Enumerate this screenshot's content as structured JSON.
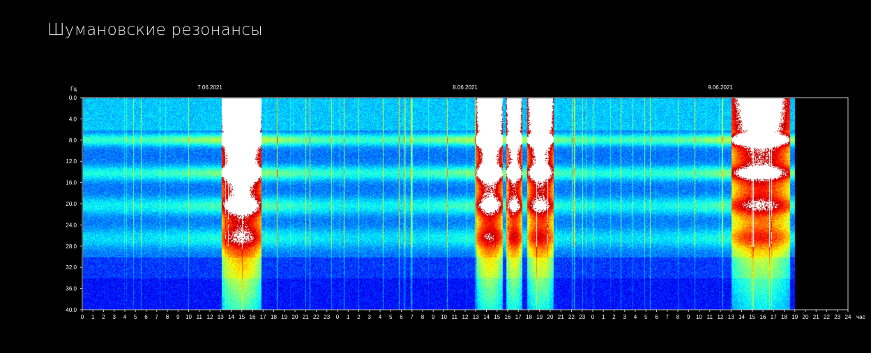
{
  "page": {
    "title": "Шумановские резонансы"
  },
  "chart_data": {
    "type": "heatmap",
    "title": "",
    "ylabel": "Гц",
    "xlabel": "час",
    "ylim": [
      0,
      40
    ],
    "y_ticks": [
      "0.0",
      "4.0",
      "8.0",
      "12.0",
      "16.0",
      "20.0",
      "24.0",
      "28.0",
      "32.0",
      "36.0",
      "40.0"
    ],
    "x_hours": [
      0,
      1,
      2,
      3,
      4,
      5,
      6,
      7,
      8,
      9,
      10,
      11,
      12,
      13,
      14,
      15,
      16,
      17,
      18,
      19,
      20,
      21,
      22,
      23,
      0,
      1,
      2,
      3,
      4,
      5,
      6,
      7,
      8,
      9,
      10,
      11,
      12,
      13,
      14,
      15,
      16,
      17,
      18,
      19,
      20,
      21,
      22,
      23,
      0,
      1,
      2,
      3,
      4,
      5,
      6,
      7,
      8,
      9,
      10,
      11,
      12,
      13,
      14,
      15,
      16,
      17,
      18,
      19,
      20,
      21,
      22,
      23,
      24
    ],
    "dates": [
      {
        "label": "7.06.2021",
        "hour": 12
      },
      {
        "label": "8.06.2021",
        "hour": 36
      },
      {
        "label": "9.06.2021",
        "hour": 60
      }
    ],
    "data_end_hour": 67,
    "resonance_bands_hz": [
      7.8,
      14.1,
      20.3,
      26.4
    ],
    "bursts": [
      {
        "start_hour": 13.0,
        "end_hour": 16.8,
        "intensity": 1.0
      },
      {
        "start_hour": 37.0,
        "end_hour": 39.5,
        "intensity": 0.9
      },
      {
        "start_hour": 39.8,
        "end_hour": 41.3,
        "intensity": 0.85
      },
      {
        "start_hour": 41.8,
        "end_hour": 44.3,
        "intensity": 0.85
      },
      {
        "start_hour": 61.0,
        "end_hour": 66.5,
        "intensity": 0.75
      }
    ],
    "colors": {
      "background": "#000000",
      "frame": "#c8c8c8"
    }
  }
}
